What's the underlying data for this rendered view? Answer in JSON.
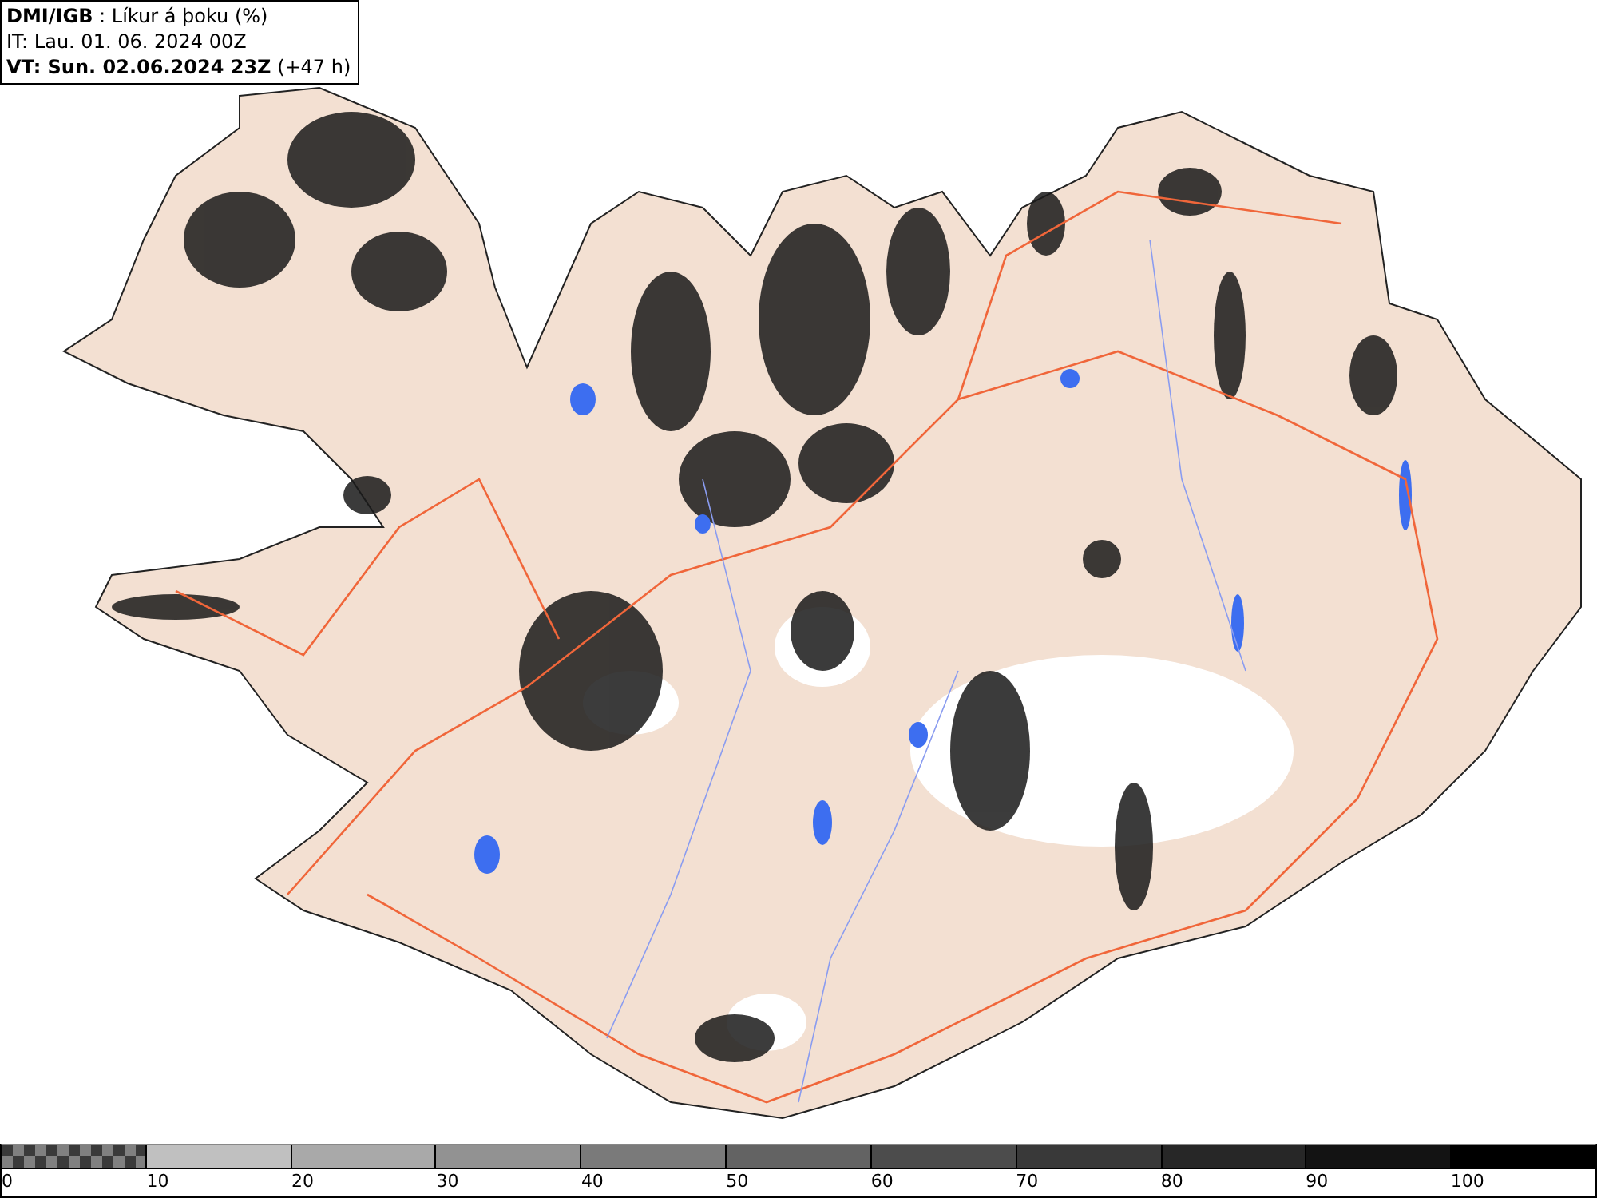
{
  "header": {
    "lines": [
      "**DMI/IGB** : Líkur á þoku (%)",
      "IT: Lau. 01. 06. 2024 00Z",
      "**VT: Sun. 02.06.2024 23Z** (+47 h)"
    ]
  },
  "legend": {
    "segments": [
      {
        "kind": "checker",
        "color": "#808080"
      },
      {
        "kind": "solid",
        "color": "#c0c0c0"
      },
      {
        "kind": "solid",
        "color": "#a9a9a9"
      },
      {
        "kind": "solid",
        "color": "#929292"
      },
      {
        "kind": "solid",
        "color": "#7a7a7a"
      },
      {
        "kind": "solid",
        "color": "#636363"
      },
      {
        "kind": "solid",
        "color": "#4c4c4c"
      },
      {
        "kind": "solid",
        "color": "#393939"
      },
      {
        "kind": "solid",
        "color": "#272727"
      },
      {
        "kind": "solid",
        "color": "#131313"
      },
      {
        "kind": "solid",
        "color": "#000000"
      }
    ],
    "ticks": [
      "0",
      "10",
      "20",
      "30",
      "40",
      "50",
      "60",
      "70",
      "80",
      "90",
      "100"
    ]
  }
}
